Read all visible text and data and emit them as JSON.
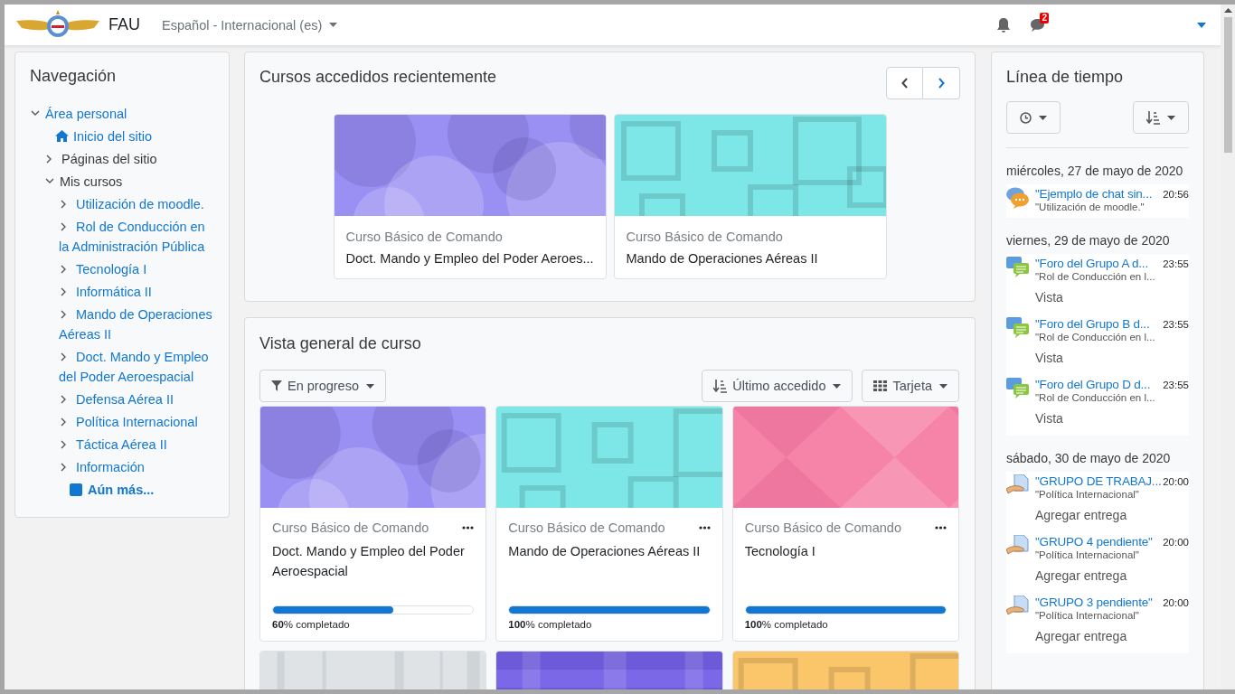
{
  "header": {
    "site_name": "FAU",
    "language": "Español - Internacional (es)",
    "message_count": "2"
  },
  "navigation": {
    "title": "Navegación",
    "items": [
      {
        "label": "Área personal",
        "kind": "link",
        "expanded": true,
        "children": [
          {
            "label": "Inicio del sitio",
            "kind": "home"
          },
          {
            "label": "Páginas del sitio",
            "kind": "section",
            "expanded": false
          },
          {
            "label": "Mis cursos",
            "kind": "section",
            "expanded": true,
            "children": [
              {
                "label": "Utilización de moodle.",
                "kind": "link",
                "expanded": false
              },
              {
                "label": "Rol de Conducción en la Administración Pública",
                "kind": "link",
                "expanded": false
              },
              {
                "label": "Tecnología I",
                "kind": "link",
                "expanded": false
              },
              {
                "label": "Informática II",
                "kind": "link",
                "expanded": false
              },
              {
                "label": "Mando de Operaciones Aéreas II",
                "kind": "link",
                "expanded": false
              },
              {
                "label": "Doct. Mando y Empleo del Poder Aeroespacial",
                "kind": "link",
                "expanded": false
              },
              {
                "label": "Defensa Aérea II",
                "kind": "link",
                "expanded": false
              },
              {
                "label": "Política Internacional",
                "kind": "link",
                "expanded": false
              },
              {
                "label": "Táctica Aérea II",
                "kind": "link",
                "expanded": false
              },
              {
                "label": "Información",
                "kind": "link",
                "expanded": false
              },
              {
                "label": "Aún más...",
                "kind": "more"
              }
            ]
          }
        ]
      }
    ]
  },
  "recent": {
    "title": "Cursos accedidos recientemente",
    "courses": [
      {
        "category": "Curso Básico de Comando",
        "name": "Doct. Mando y Empleo del Poder Aeroes..."
      },
      {
        "category": "Curso Básico de Comando",
        "name": "Mando de Operaciones Aéreas II"
      }
    ]
  },
  "overview": {
    "title": "Vista general de curso",
    "filter": "En progreso",
    "sort": "Último accedido",
    "view": "Tarjeta",
    "courses": [
      {
        "category": "Curso Básico de Comando",
        "name": "Doct. Mando y Empleo del Poder Aeroespacial",
        "level": 0.6,
        "progress": "**60**% completado"
      },
      {
        "category": "Curso Básico de Comando",
        "name": "Mando de Operaciones Aéreas II",
        "level": 1,
        "progress": "**100**% completado"
      },
      {
        "category": "Curso Básico de Comando",
        "name": "Tecnología I",
        "level": 1,
        "progress": "**100**% completado"
      },
      {
        "kind": "picture"
      },
      {
        "kind": "picture"
      },
      {
        "kind": "picture"
      }
    ]
  },
  "timeline": {
    "title": "Línea de tiempo",
    "days": [
      {
        "date": "miércoles, 27 de mayo de 2020",
        "events": [
          {
            "kind": "chat",
            "title": "\"Ejemplo de chat sin...",
            "time": "20:56",
            "course": "\"Utilización de moodle.\""
          }
        ]
      },
      {
        "date": "viernes, 29 de mayo de 2020",
        "events": [
          {
            "kind": "forum",
            "title": "\"Foro del Grupo A d...",
            "time": "23:55",
            "course": "\"Rol de Conducción en l...",
            "action": "Vista"
          },
          {
            "kind": "forum",
            "title": "\"Foro del Grupo B d...",
            "time": "23:55",
            "course": "\"Rol de Conducción en l...",
            "action": "Vista"
          },
          {
            "kind": "forum",
            "title": "\"Foro del Grupo D d...",
            "time": "23:55",
            "course": "\"Rol de Conducción en l...",
            "action": "Vista"
          }
        ]
      },
      {
        "date": "sábado, 30 de mayo de 2020",
        "events": [
          {
            "kind": "assign",
            "title": "\"GRUPO DE TRABAJ...",
            "time": "20:00",
            "course": "\"Política Internacional\"",
            "action": "Agregar entrega"
          },
          {
            "kind": "assign",
            "title": "\"GRUPO 4 pendiente\"",
            "time": "20:00",
            "course": "\"Política Internacional\"",
            "action": "Agregar entrega"
          },
          {
            "kind": "assign",
            "title": "\"GRUPO 3 pendiente\"",
            "time": "20:00",
            "course": "\"Política Internacional\"",
            "action": "Agregar entrega"
          }
        ]
      }
    ]
  }
}
